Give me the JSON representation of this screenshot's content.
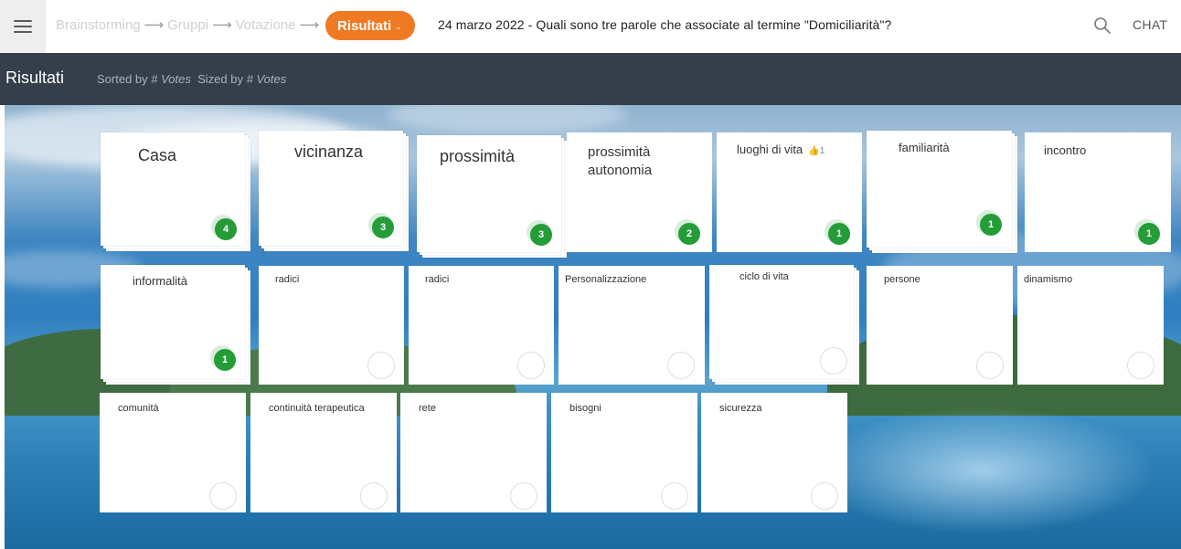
{
  "topbar": {
    "steps": [
      "Brainstorming",
      "Gruppi",
      "Votazione"
    ],
    "arrow": "⟶",
    "active_step": "Risultati",
    "caret": "⌄",
    "session_title": "24 marzo 2022 - Quali sono tre parole che associate al termine \"Domiciliarità\"?",
    "chat_label": "CHAT",
    "menu_icon": "hamburger-icon",
    "search_icon": "search-icon"
  },
  "results_bar": {
    "title": "Risultati",
    "sorted_prefix": "Sorted by",
    "sorted_value": "# Votes",
    "sized_prefix": "Sized by",
    "sized_value": "# Votes"
  },
  "colors": {
    "accent": "#f07923",
    "badge": "#259c38",
    "results_bar": "#343f4b"
  },
  "cards": [
    {
      "label": "Casa",
      "votes": "4"
    },
    {
      "label": "vicinanza",
      "votes": "3"
    },
    {
      "label": "prossimità",
      "votes": "3"
    },
    {
      "label": "prossimità autonomia",
      "votes": "2"
    },
    {
      "label": "luoghi di vita",
      "votes": "1",
      "likes": "1"
    },
    {
      "label": "familiarità",
      "votes": "1"
    },
    {
      "label": "incontro",
      "votes": "1"
    },
    {
      "label": "informalità",
      "votes": "1"
    },
    {
      "label": "radici",
      "votes": ""
    },
    {
      "label": "radici",
      "votes": ""
    },
    {
      "label": "Personalizzazione",
      "votes": ""
    },
    {
      "label": "ciclo di vita",
      "votes": ""
    },
    {
      "label": "persone",
      "votes": ""
    },
    {
      "label": "dinamismo",
      "votes": ""
    },
    {
      "label": "comunità",
      "votes": ""
    },
    {
      "label": "continuità terapeutica",
      "votes": ""
    },
    {
      "label": "rete",
      "votes": ""
    },
    {
      "label": "bisogni",
      "votes": ""
    },
    {
      "label": "sicurezza",
      "votes": ""
    }
  ]
}
